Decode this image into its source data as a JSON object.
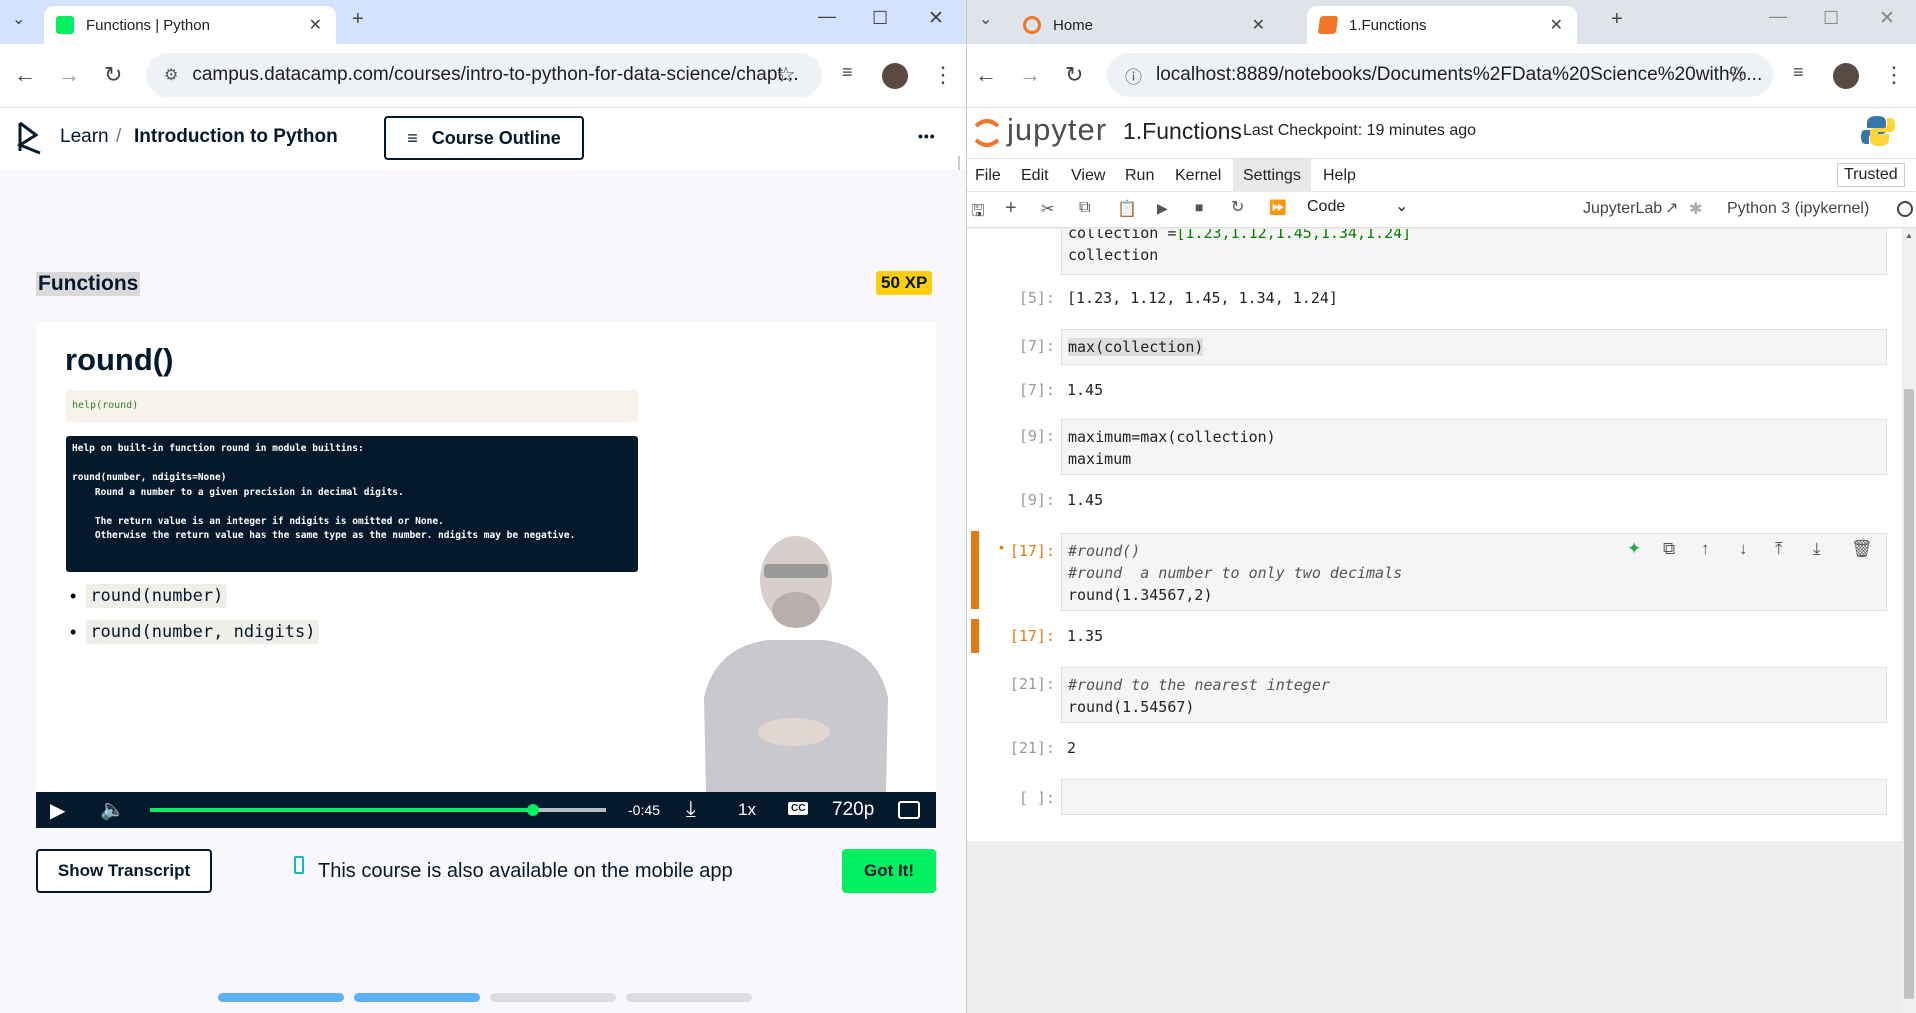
{
  "left_browser": {
    "tab_title": "Functions | Python",
    "url": "campus.datacamp.com/courses/intro-to-python-for-data-science/chapt...",
    "header": {
      "learn": "Learn",
      "separator": "/",
      "course": "Introduction to Python",
      "outline_button": "Course Outline",
      "more": "•••"
    },
    "exercise_title": "Functions",
    "xp_badge": "50 XP",
    "slide": {
      "heading": "round()",
      "help_code": "help(round)",
      "terminal_lines": [
        "Help on built-in function round in module builtins:",
        "",
        "round(number, ndigits=None)",
        "    Round a number to a given precision in decimal digits.",
        "",
        "    The return value is an integer if ndigits is omitted or None.",
        "    Otherwise the return value has the same type as the number. ndigits may be negative."
      ],
      "bullets": [
        "round(number)",
        "round(number, ndigits)"
      ]
    },
    "video_controls": {
      "time": "-0:45",
      "speed": "1x",
      "cc": "CC",
      "quality": "720p",
      "progress": 0.84
    },
    "show_transcript": "Show Transcript",
    "mobile_notice": "This course is also available on the mobile app",
    "got_it": "Got It!"
  },
  "right_browser": {
    "tabs": [
      {
        "title": "Home",
        "active": false
      },
      {
        "title": "1.Functions",
        "active": true
      }
    ],
    "url": "localhost:8889/notebooks/Documents%2FData%20Science%20with%...",
    "jupyter": {
      "logo_text": "jupyter",
      "notebook_name": "1.Functions",
      "checkpoint": "Last Checkpoint: 19 minutes ago",
      "menu": [
        "File",
        "Edit",
        "View",
        "Run",
        "Kernel",
        "Settings",
        "Help"
      ],
      "trusted": "Trusted",
      "cell_type": "Code",
      "jupyterlab_link": "JupyterLab",
      "kernel": "Python 3 (ipykernel)"
    },
    "cells": [
      {
        "prompt": "[5]:",
        "output": "[1.23, 1.12, 1.45, 1.34, 1.24]"
      },
      {
        "prompt": "[7]:",
        "input": "max(collection)",
        "output": "1.45"
      },
      {
        "prompt": "[9]:",
        "input_lines": [
          "maximum=max(collection)",
          "maximum"
        ],
        "output": "1.45"
      },
      {
        "prompt": "[17]:",
        "input_lines": [
          "#round()",
          "#round  a number to only two decimals",
          "round(1.34567,2)"
        ],
        "output": "1.35"
      },
      {
        "prompt": "[21]:",
        "input_lines": [
          "#round to the nearest integer",
          "round(1.54567)"
        ],
        "output": "2"
      },
      {
        "prompt": "[ ]:"
      }
    ],
    "top_partial": {
      "line1_prefix": "collection =",
      "line1_values": "[1.23,1.12,1.45,1.34,1.24]",
      "line2": "collection"
    }
  }
}
